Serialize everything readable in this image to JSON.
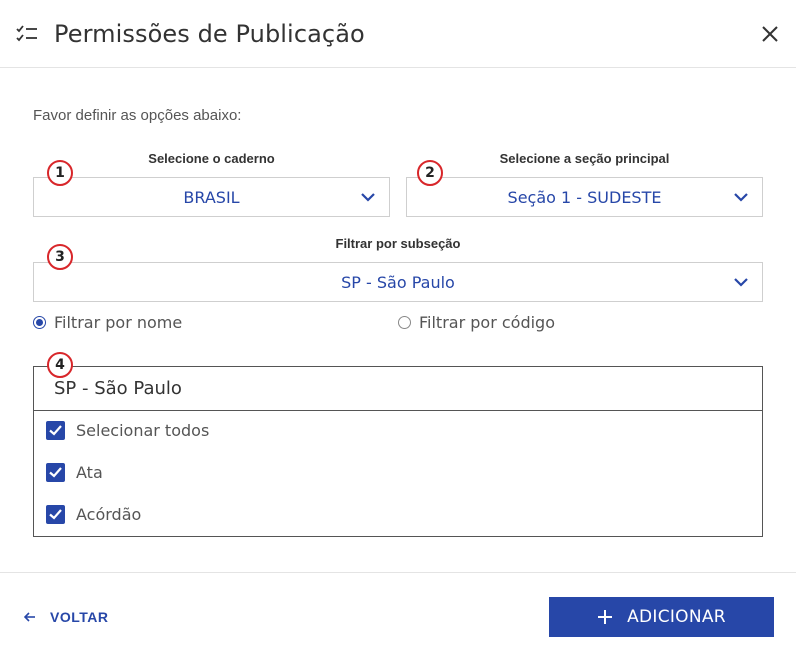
{
  "dialog": {
    "title": "Permissões de Publicação",
    "instructions": "Favor definir as opções abaixo:"
  },
  "fields": {
    "caderno": {
      "label": "Selecione o caderno",
      "value": "BRASIL",
      "badge": "1"
    },
    "secao": {
      "label": "Selecione a seção principal",
      "value": "Seção 1 - SUDESTE",
      "badge": "2"
    },
    "subsecao": {
      "label": "Filtrar por subseção",
      "value": "SP - São Paulo",
      "badge": "3"
    }
  },
  "filter_mode": {
    "options": [
      {
        "label": "Filtrar por nome",
        "checked": true
      },
      {
        "label": "Filtrar por código",
        "checked": false
      }
    ]
  },
  "list": {
    "badge": "4",
    "header": "SP - São Paulo",
    "items": [
      {
        "label": "Selecionar todos",
        "checked": true
      },
      {
        "label": "Ata",
        "checked": true
      },
      {
        "label": "Acórdão",
        "checked": true
      }
    ]
  },
  "footer": {
    "back_label": "VOLTAR",
    "add_label": "ADICIONAR"
  },
  "colors": {
    "accent": "#2747a8",
    "badge_border": "#d8262a"
  },
  "icons": {
    "header": "checklist-icon",
    "close": "close-icon",
    "dropdown": "chevron-down-icon",
    "back": "arrow-left-icon",
    "add": "plus-icon"
  }
}
